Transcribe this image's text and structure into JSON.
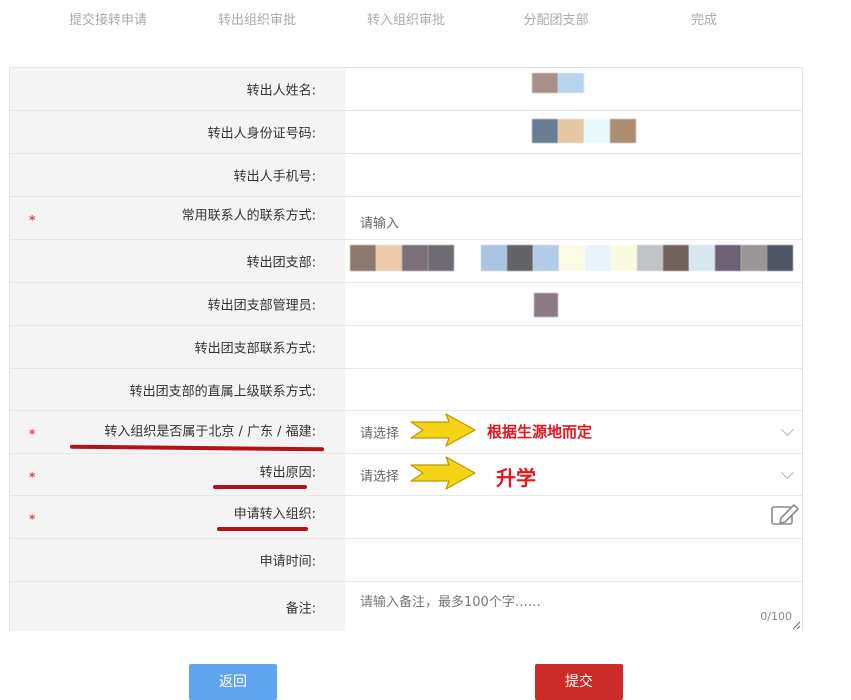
{
  "steps": [
    "提交接转申请",
    "转出组织审批",
    "转入组织审批",
    "分配团支部",
    "完成"
  ],
  "fields": {
    "name_label": "转出人姓名:",
    "id_label": "转出人身份证号码:",
    "phone_label": "转出人手机号:",
    "contact_label": "常用联系人的联系方式:",
    "contact_placeholder": "请输入",
    "branch_label": "转出团支部:",
    "admin_label": "转出团支部管理员:",
    "branch_contact_label": "转出团支部联系方式:",
    "superior_contact_label": "转出团支部的直属上级联系方式:",
    "region_label": "转入组织是否属于北京 / 广东 / 福建:",
    "region_placeholder": "请选择",
    "reason_label": "转出原因:",
    "reason_placeholder": "请选择",
    "apply_org_label": "申请转入组织:",
    "apply_time_label": "申请时间:",
    "remark_label": "备注:",
    "remark_placeholder": "请输入备注，最多100个字……",
    "remark_counter": "0/100"
  },
  "annotations": {
    "region_note": "根据生源地而定",
    "reason_note": "升学"
  },
  "buttons": {
    "back": "返回",
    "submit": "提交"
  },
  "colors": {
    "back_button": "#5fa4ee",
    "submit_button": "#cc2b27",
    "required_star": "#e04a3a",
    "annotation_red": "#e8141c",
    "underline": "#b3121a",
    "arrow_fill": "#f5d316"
  }
}
